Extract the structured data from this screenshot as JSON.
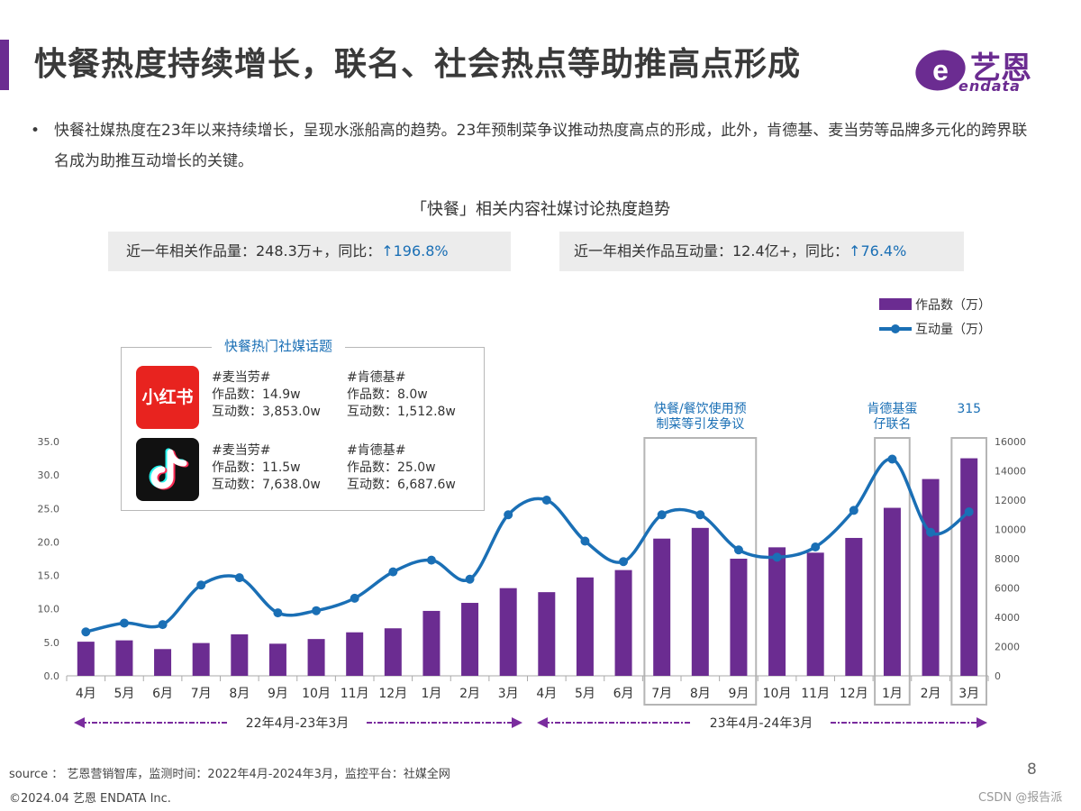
{
  "header": {
    "title": "快餐热度持续增长，联名、社会热点等助推高点形成",
    "accent_color": "#6b2c91",
    "logo_cn": "艺恩",
    "logo_en": "endata"
  },
  "bullet": {
    "text": "快餐社媒热度在23年以来持续增长，呈现水涨船高的趋势。23年预制菜争议推动热度高点的形成，此外，肯德基、麦当劳等品牌多元化的跨界联名成为助推互动增长的关键。"
  },
  "chart_title": "「快餐」相关内容社媒讨论热度趋势",
  "stats": [
    {
      "label": "近一年相关作品量：248.3万+，同比：",
      "value": "↑196.8%"
    },
    {
      "label": "近一年相关作品互动量：12.4亿+，同比：",
      "value": "↑76.4%"
    }
  ],
  "topics": {
    "title": "快餐热门社媒话题",
    "platforms": [
      {
        "icon": "xiaohongshu-icon",
        "icon_text": "小红书",
        "items": [
          {
            "tag": "#麦当劳#",
            "works": "作品数：14.9w",
            "interact": "互动数：3,853.0w"
          },
          {
            "tag": "#肯德基#",
            "works": "作品数：8.0w",
            "interact": "互动数：1,512.8w"
          }
        ]
      },
      {
        "icon": "douyin-icon",
        "icon_text": "",
        "items": [
          {
            "tag": "#麦当劳#",
            "works": "作品数：11.5w",
            "interact": "互动数：7,638.0w"
          },
          {
            "tag": "#肯德基#",
            "works": "作品数：25.0w",
            "interact": "互动数：6,687.6w"
          }
        ]
      }
    ]
  },
  "chart_data": {
    "type": "bar",
    "categories": [
      "4月",
      "5月",
      "6月",
      "7月",
      "8月",
      "9月",
      "10月",
      "11月",
      "12月",
      "1月",
      "2月",
      "3月",
      "4月",
      "5月",
      "6月",
      "7月",
      "8月",
      "9月",
      "10月",
      "11月",
      "12月",
      "1月",
      "2月",
      "3月"
    ],
    "series": [
      {
        "name": "作品数（万）",
        "type": "bar",
        "axis": "left",
        "color": "#6b2c91",
        "values": [
          5.1,
          5.3,
          4.0,
          4.9,
          6.2,
          4.8,
          5.5,
          6.5,
          7.1,
          9.7,
          10.9,
          13.1,
          12.5,
          14.7,
          15.8,
          20.5,
          22.1,
          17.5,
          19.2,
          18.4,
          20.6,
          25.1,
          29.4,
          32.5
        ]
      },
      {
        "name": "互动量（万）",
        "type": "line",
        "axis": "right",
        "color": "#1a6fb5",
        "values": [
          3000,
          3600,
          3500,
          6200,
          6700,
          4300,
          4450,
          5300,
          7100,
          7900,
          6600,
          11000,
          12000,
          9200,
          7800,
          11000,
          11000,
          8600,
          8100,
          8800,
          11300,
          14800,
          9800,
          11200
        ]
      }
    ],
    "ylim_left": [
      0,
      35
    ],
    "yticks_left": [
      "0.0",
      "5.0",
      "10.0",
      "15.0",
      "20.0",
      "25.0",
      "30.0",
      "35.0"
    ],
    "ylim_right": [
      0,
      16000
    ],
    "yticks_right": [
      "0",
      "2000",
      "4000",
      "6000",
      "8000",
      "10000",
      "12000",
      "14000",
      "16000"
    ],
    "grid": false,
    "legend_placement": "top-right",
    "annotations": [
      {
        "text_lines": [
          "快餐/餐饮使用预",
          "制菜等引发争议"
        ],
        "range": [
          "7月",
          "9月"
        ]
      },
      {
        "text_lines": [
          "肯德基蛋",
          "仔联名"
        ],
        "range": [
          "1月",
          "1月"
        ]
      },
      {
        "text_lines": [
          "315"
        ],
        "range": [
          "3月",
          "3月"
        ]
      }
    ],
    "periods": [
      "22年4月-23年3月",
      "23年4月-24年3月"
    ]
  },
  "footer": {
    "source": "source ： 艺恩营销智库，监测时间：2022年4月-2024年3月，监控平台：社媒全网",
    "copyright": "©2024.04  艺恩 ENDATA Inc.",
    "page": "8",
    "watermark": "CSDN @报告派"
  }
}
